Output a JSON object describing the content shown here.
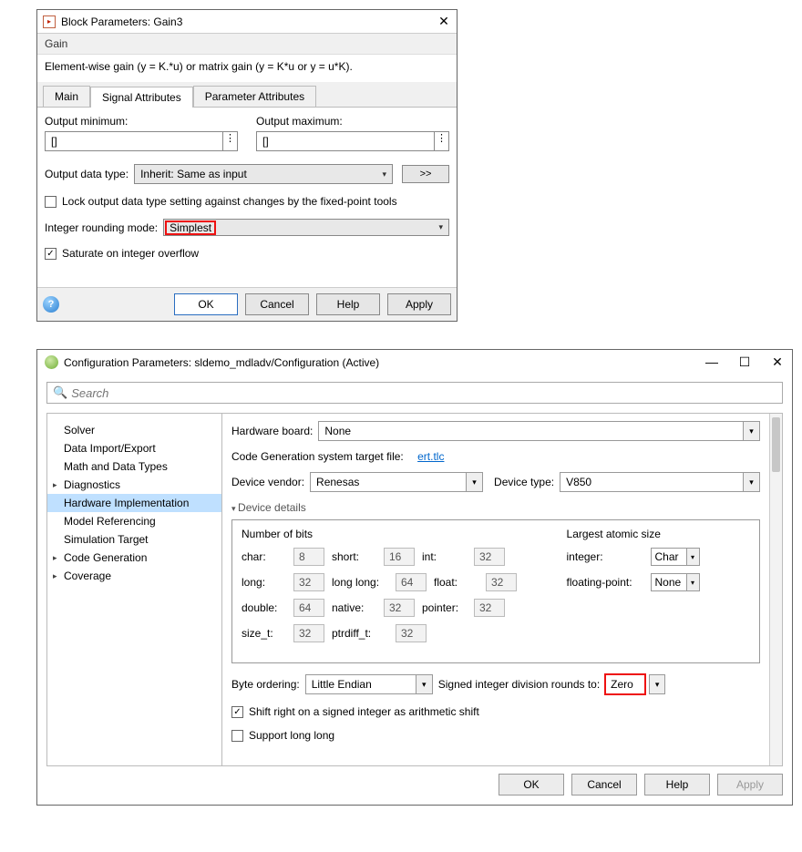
{
  "win1": {
    "title": "Block Parameters: Gain3",
    "header_label": "Gain",
    "header_desc": "Element-wise gain (y = K.*u) or matrix gain (y = K*u or y = u*K).",
    "tabs": {
      "main": "Main",
      "sig": "Signal Attributes",
      "param": "Parameter Attributes"
    },
    "out_min_label": "Output minimum:",
    "out_min_value": "[]",
    "out_max_label": "Output maximum:",
    "out_max_value": "[]",
    "dots": "⋮",
    "odt_label": "Output data type:",
    "odt_value": "Inherit: Same as input",
    "odt_more": ">>",
    "lock_label": "Lock output data type setting against changes by the fixed-point tools",
    "irm_label": "Integer rounding mode:",
    "irm_value": "Simplest",
    "sat_label": "Saturate on integer overflow",
    "buttons": {
      "ok": "OK",
      "cancel": "Cancel",
      "help": "Help",
      "apply": "Apply"
    }
  },
  "win2": {
    "title": "Configuration Parameters: sldemo_mdladv/Configuration (Active)",
    "search_placeholder": "Search",
    "winctl": {
      "min": "—",
      "max": "☐",
      "close": "✕"
    },
    "tree": {
      "solver": "Solver",
      "dio": "Data Import/Export",
      "math": "Math and Data Types",
      "diag": "Diagnostics",
      "hw": "Hardware Implementation",
      "modelref": "Model Referencing",
      "simtgt": "Simulation Target",
      "codegen": "Code Generation",
      "cov": "Coverage"
    },
    "hw_board_label": "Hardware board:",
    "hw_board_value": "None",
    "cg_stf_label": "Code Generation system target file:",
    "cg_stf_link": "ert.tlc",
    "dev_vendor_label": "Device vendor:",
    "dev_vendor_value": "Renesas",
    "dev_type_label": "Device type:",
    "dev_type_value": "V850",
    "dev_details_label": "Device details",
    "bits_title": "Number of bits",
    "atomic_title": "Largest atomic size",
    "bits": {
      "char_l": "char:",
      "char_v": "8",
      "short_l": "short:",
      "short_v": "16",
      "int_l": "int:",
      "int_v": "32",
      "long_l": "long:",
      "long_v": "32",
      "ll_l": "long long:",
      "ll_v": "64",
      "float_l": "float:",
      "float_v": "32",
      "dbl_l": "double:",
      "dbl_v": "64",
      "nat_l": "native:",
      "nat_v": "32",
      "ptr_l": "pointer:",
      "ptr_v": "32",
      "szt_l": "size_t:",
      "szt_v": "32",
      "ptd_l": "ptrdiff_t:",
      "ptd_v": "32"
    },
    "atomic": {
      "int_l": "integer:",
      "int_v": "Char",
      "fp_l": "floating-point:",
      "fp_v": "None"
    },
    "byte_label": "Byte ordering:",
    "byte_value": "Little Endian",
    "sdiv_label": "Signed integer division rounds to:",
    "sdiv_value": "Zero",
    "shift_label": "Shift right on a signed integer as arithmetic shift",
    "sll_label": "Support long long",
    "buttons": {
      "ok": "OK",
      "cancel": "Cancel",
      "help": "Help",
      "apply": "Apply"
    }
  }
}
